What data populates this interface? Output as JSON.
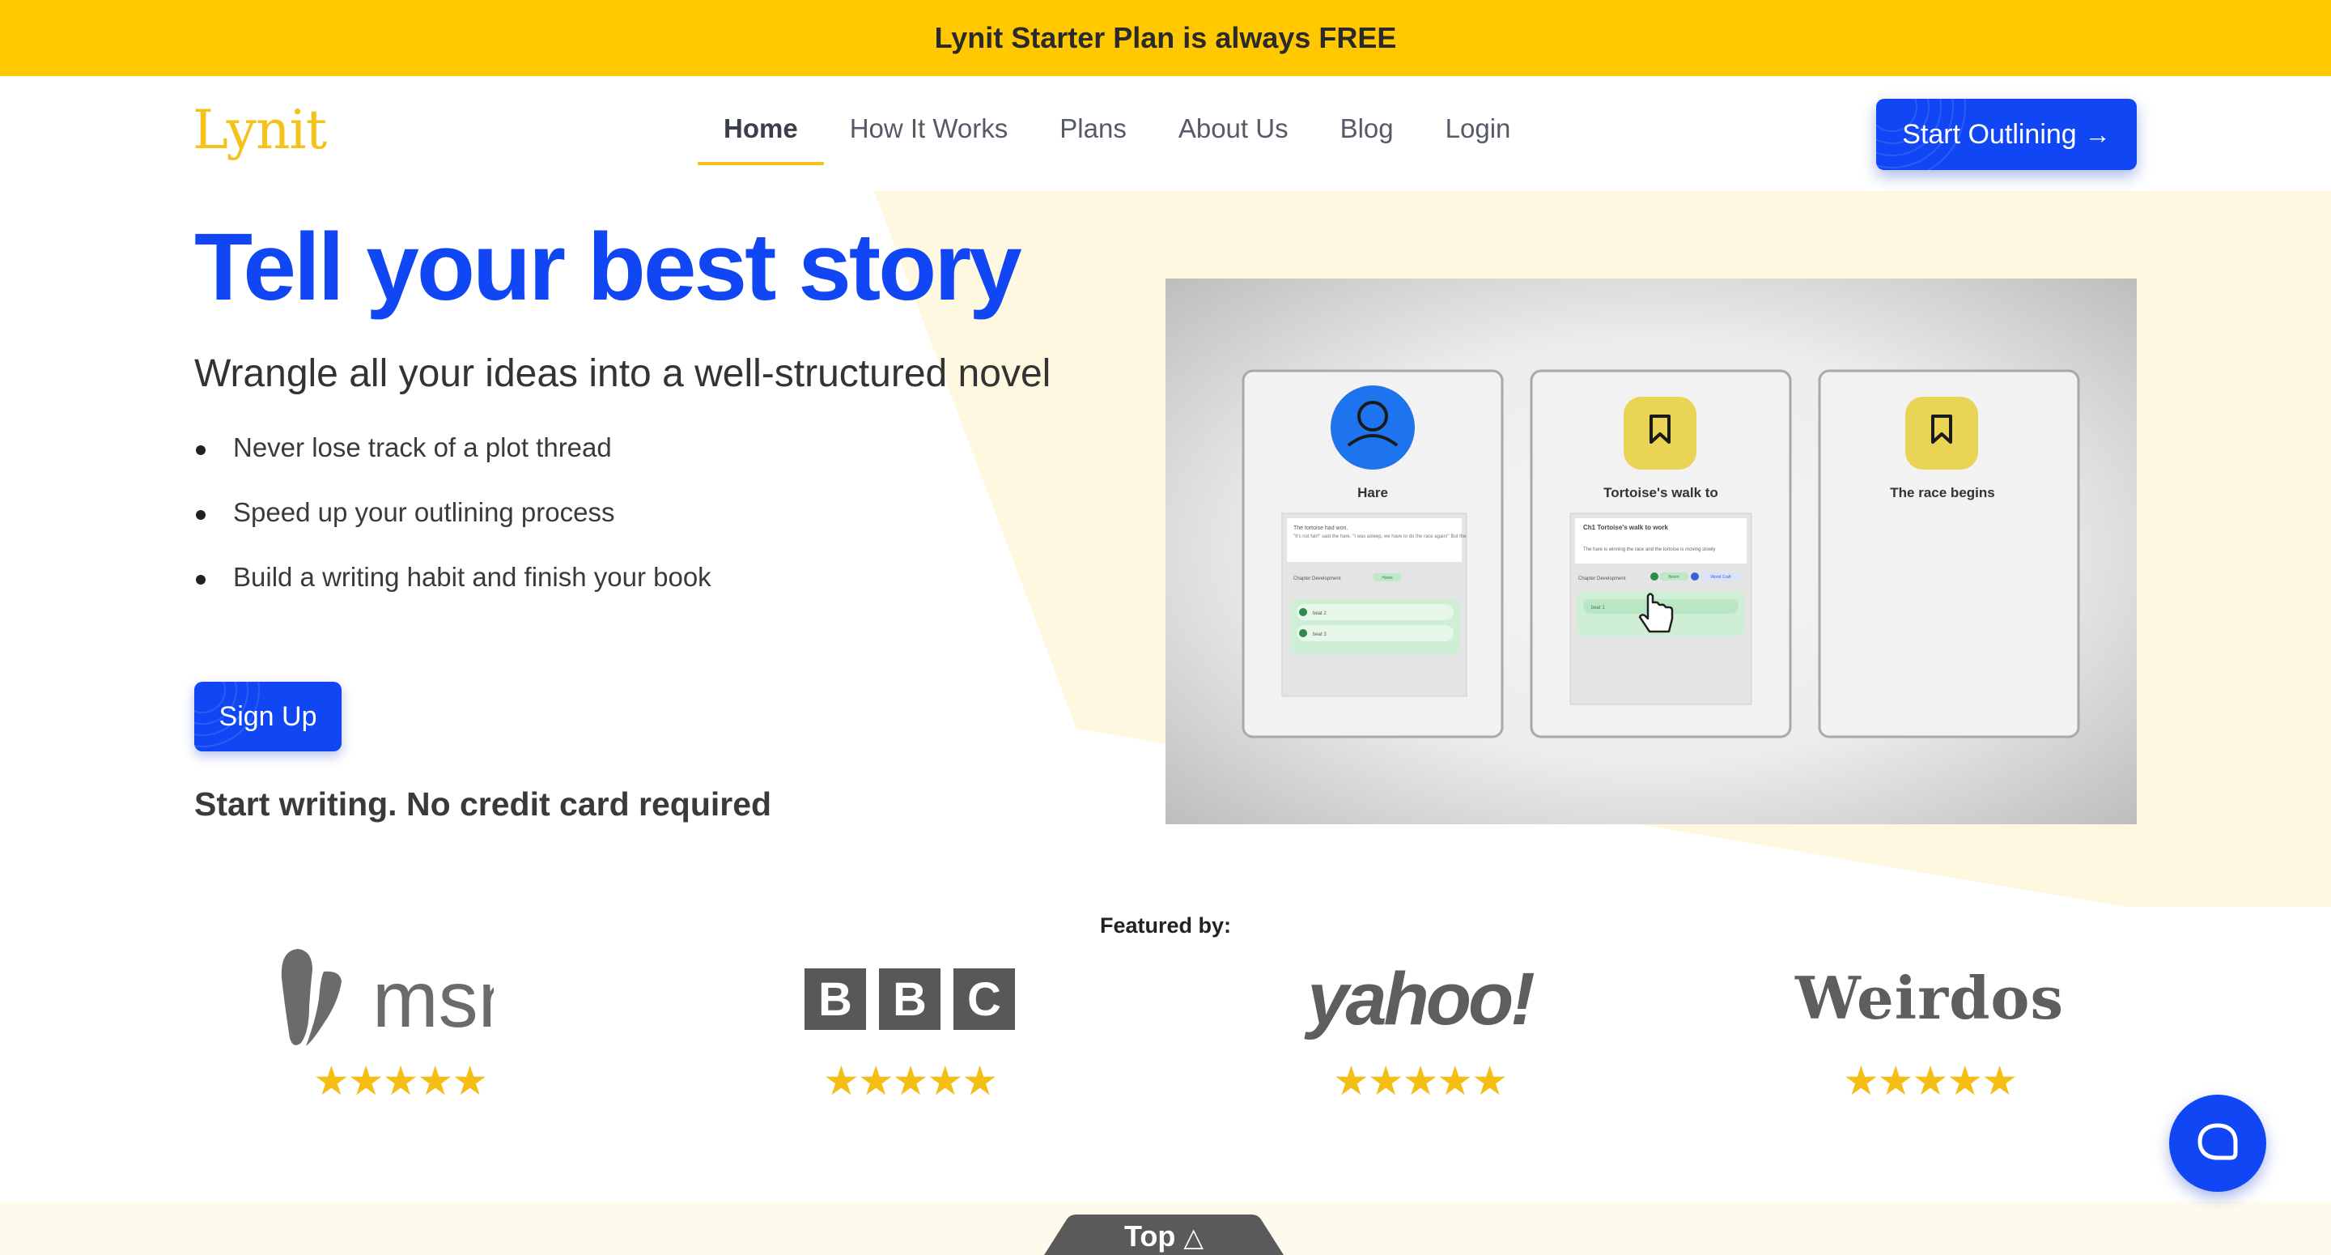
{
  "announcement": {
    "text": "Lynit Starter Plan is always FREE"
  },
  "header": {
    "logo": "Lynit",
    "nav": [
      {
        "label": "Home",
        "active": true
      },
      {
        "label": "How It Works"
      },
      {
        "label": "Plans"
      },
      {
        "label": "About Us"
      },
      {
        "label": "Blog"
      },
      {
        "label": "Login"
      }
    ],
    "cta_label": "Start Outlining",
    "cta_icon": "arrow-right-icon"
  },
  "hero": {
    "title": "Tell your best story",
    "subtitle": "Wrangle all your ideas into a well-structured novel",
    "bullets": [
      "Never lose track of a plot thread",
      "Speed up your outlining process",
      "Build a writing habit and finish your book"
    ],
    "signup_label": "Sign Up",
    "note": "Start writing. No credit card required"
  },
  "video": {
    "cards": [
      {
        "title": "Hare",
        "icon": "person-icon",
        "snippet_1": "The tortoise had won.",
        "snippet_2": "\"It's not fair!\" said the hare. \"I was asleep, we have to do the race again!\" But the",
        "tag": "Chapter Development",
        "pill": "Hares",
        "beats": [
          "beat 2",
          "beat 3"
        ]
      },
      {
        "title": "Tortoise's walk to",
        "icon": "bookmark-icon",
        "snippet_1": "Ch1 Tortoise's walk to work",
        "snippet_2": "The hare is winning the race and the tortoise is moving slowly",
        "tag": "Chapter Development",
        "pill": "Boom",
        "pill_2": "World Craft",
        "beats": [
          "beat 1"
        ]
      },
      {
        "title": "The race begins",
        "icon": "bookmark-icon"
      }
    ]
  },
  "press": {
    "label": "Featured by:",
    "outlets": [
      {
        "name": "msn",
        "stars": "★★★★★"
      },
      {
        "name": "BBC",
        "letters": [
          "B",
          "B",
          "C"
        ],
        "stars": "★★★★★"
      },
      {
        "name": "yahoo!",
        "stars": "★★★★★"
      },
      {
        "name": "Weirdos",
        "stars": "★★★★★"
      }
    ]
  },
  "footer": {
    "top_label": "Top"
  },
  "colors": {
    "brand_blue": "#1146F4",
    "brand_yellow": "#FFC800",
    "logo_yellow": "#F4C21A",
    "star": "#F4BE14"
  }
}
